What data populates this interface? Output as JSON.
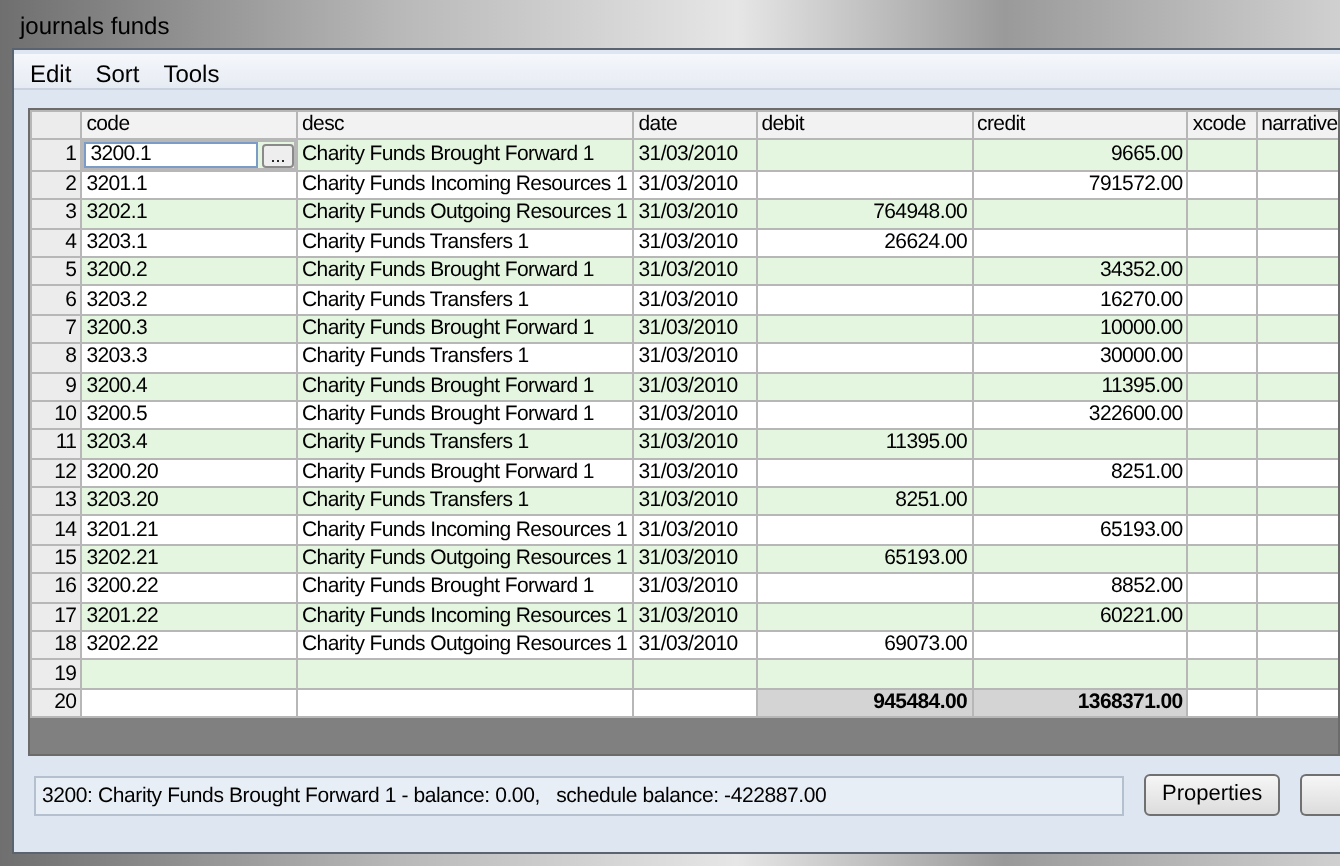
{
  "window": {
    "title": "journals funds"
  },
  "menu": [
    "Edit",
    "Sort",
    "Tools"
  ],
  "table": {
    "columns": [
      "code",
      "desc",
      "date",
      "debit",
      "credit",
      "xcode",
      "narrative"
    ],
    "rows": [
      {
        "kind": "entry",
        "number": "1",
        "code": "3200.1",
        "desc": "Charity Funds Brought Forward 1",
        "date": "31/03/2010",
        "debit": "",
        "credit": "9665.00",
        "editing": true,
        "picker": "..."
      },
      {
        "kind": "entry",
        "number": "2",
        "code": "3201.1",
        "desc": "Charity Funds Incoming Resources 1",
        "date": "31/03/2010",
        "debit": "",
        "credit": "791572.00"
      },
      {
        "kind": "entry",
        "number": "3",
        "code": "3202.1",
        "desc": "Charity Funds Outgoing Resources 1",
        "date": "31/03/2010",
        "debit": "764948.00",
        "credit": ""
      },
      {
        "kind": "entry",
        "number": "4",
        "code": "3203.1",
        "desc": "Charity Funds Transfers 1",
        "date": "31/03/2010",
        "debit": "26624.00",
        "credit": ""
      },
      {
        "kind": "entry",
        "number": "5",
        "code": "3200.2",
        "desc": "Charity Funds Brought Forward 1",
        "date": "31/03/2010",
        "debit": "",
        "credit": "34352.00"
      },
      {
        "kind": "entry",
        "number": "6",
        "code": "3203.2",
        "desc": "Charity Funds Transfers 1",
        "date": "31/03/2010",
        "debit": "",
        "credit": "16270.00"
      },
      {
        "kind": "entry",
        "number": "7",
        "code": "3200.3",
        "desc": "Charity Funds Brought Forward 1",
        "date": "31/03/2010",
        "debit": "",
        "credit": "10000.00"
      },
      {
        "kind": "entry",
        "number": "8",
        "code": "3203.3",
        "desc": "Charity Funds Transfers 1",
        "date": "31/03/2010",
        "debit": "",
        "credit": "30000.00"
      },
      {
        "kind": "entry",
        "number": "9",
        "code": "3200.4",
        "desc": "Charity Funds Brought Forward 1",
        "date": "31/03/2010",
        "debit": "",
        "credit": "11395.00"
      },
      {
        "kind": "entry",
        "number": "10",
        "code": "3200.5",
        "desc": "Charity Funds Brought Forward 1",
        "date": "31/03/2010",
        "debit": "",
        "credit": "322600.00"
      },
      {
        "kind": "entry",
        "number": "11",
        "code": "3203.4",
        "desc": "Charity Funds Transfers 1",
        "date": "31/03/2010",
        "debit": "11395.00",
        "credit": ""
      },
      {
        "kind": "entry",
        "number": "12",
        "code": "3200.20",
        "desc": "Charity Funds Brought Forward 1",
        "date": "31/03/2010",
        "debit": "",
        "credit": "8251.00"
      },
      {
        "kind": "entry",
        "number": "13",
        "code": "3203.20",
        "desc": "Charity Funds Transfers 1",
        "date": "31/03/2010",
        "debit": "8251.00",
        "credit": ""
      },
      {
        "kind": "entry",
        "number": "14",
        "code": "3201.21",
        "desc": "Charity Funds Incoming Resources 1",
        "date": "31/03/2010",
        "debit": "",
        "credit": "65193.00"
      },
      {
        "kind": "entry",
        "number": "15",
        "code": "3202.21",
        "desc": "Charity Funds Outgoing Resources 1",
        "date": "31/03/2010",
        "debit": "65193.00",
        "credit": ""
      },
      {
        "kind": "entry",
        "number": "16",
        "code": "3200.22",
        "desc": "Charity Funds Brought Forward 1",
        "date": "31/03/2010",
        "debit": "",
        "credit": "8852.00"
      },
      {
        "kind": "entry",
        "number": "17",
        "code": "3201.22",
        "desc": "Charity Funds Incoming Resources 1",
        "date": "31/03/2010",
        "debit": "",
        "credit": "60221.00"
      },
      {
        "kind": "entry",
        "number": "18",
        "code": "3202.22",
        "desc": "Charity Funds Outgoing Resources 1",
        "date": "31/03/2010",
        "debit": "69073.00",
        "credit": ""
      },
      {
        "kind": "entry",
        "number": "19",
        "code": "",
        "desc": "",
        "date": "",
        "debit": "",
        "credit": ""
      },
      {
        "kind": "total",
        "number": "20",
        "debit": "945484.00",
        "credit": "1368371.00"
      }
    ]
  },
  "status_bar": {
    "text": "3200: Charity Funds Brought Forward 1 - balance: 0.00,   schedule balance: -422887.00"
  },
  "buttons": [
    "Properties"
  ]
}
